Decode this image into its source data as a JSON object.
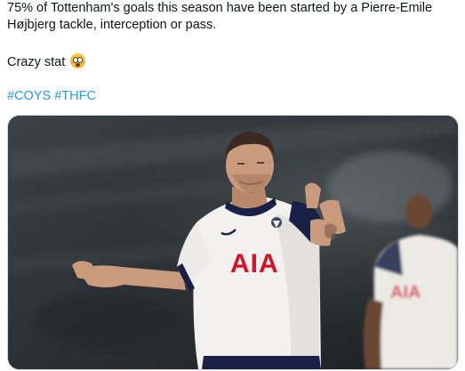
{
  "tweet": {
    "lines": [
      "75% of Tottenham's goals this season have been started by a Pierre-Emile",
      "Højbjerg tackle, interception or pass."
    ],
    "comment": "Crazy stat",
    "emoji": "flushed-face-emoji",
    "hashtags": [
      "#COYS",
      "#THFC"
    ]
  },
  "photo": {
    "shirt_sponsor": "AIA",
    "colors": {
      "shirt": "#f2f1ee",
      "sponsor": "#d6122b",
      "trim": "#1a2147",
      "skin": "#c99a7b",
      "dark_skin": "#6b4632",
      "background": "#2a2f33"
    }
  },
  "colors": {
    "text": "#0f1419",
    "link": "#1d9bf0",
    "border": "#cfd9de"
  }
}
